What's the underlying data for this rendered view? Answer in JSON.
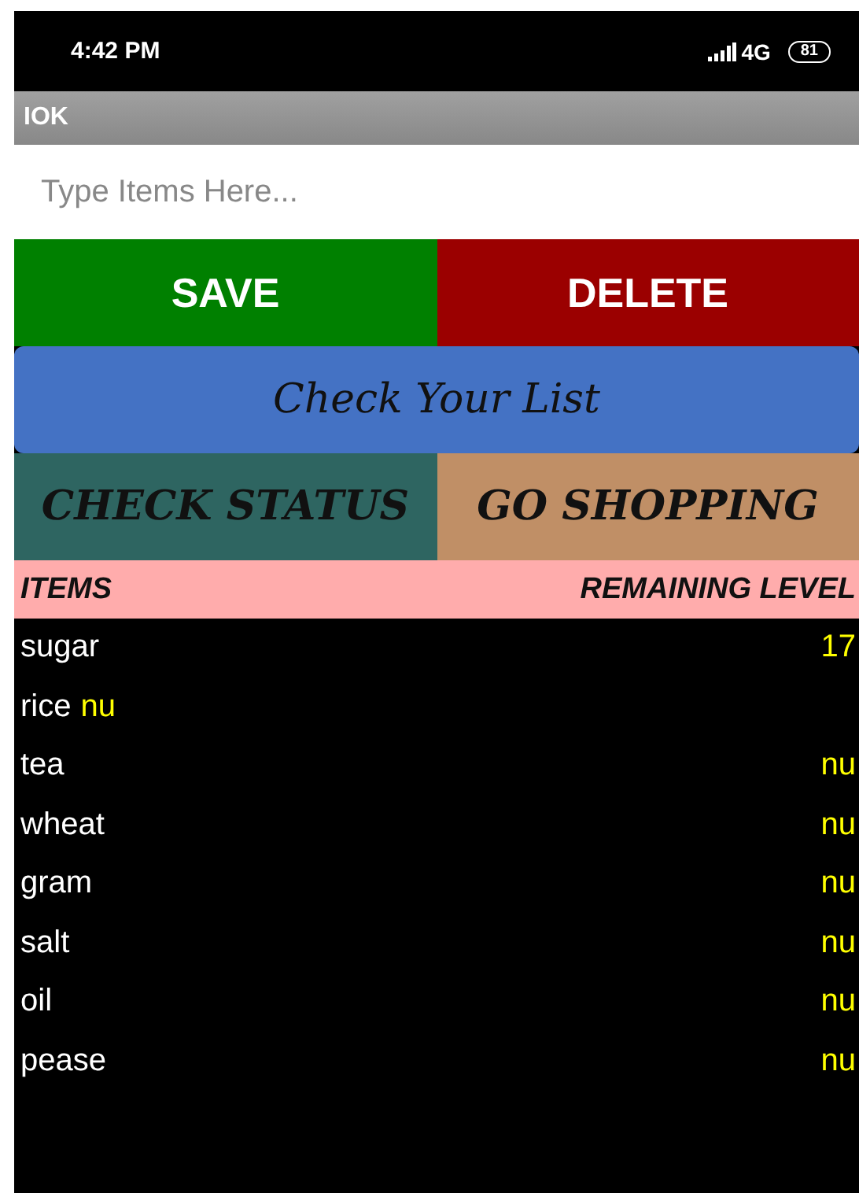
{
  "status_bar": {
    "time": "4:42 PM",
    "network": "4G",
    "battery": "81"
  },
  "app_bar": {
    "title": "IOK"
  },
  "input": {
    "placeholder": "Type Items Here..."
  },
  "buttons": [
    {
      "label": "SAVE",
      "color": "#008000"
    },
    {
      "label": "DELETE",
      "color": "#9b0000"
    }
  ],
  "list_button": {
    "label": "Check Your List"
  },
  "actions": [
    {
      "label": "CHECK STATUS",
      "color": "#2e6561"
    },
    {
      "label": "GO SHOPPING",
      "color": "#c08f66"
    }
  ],
  "table": {
    "columns": [
      "ITEMS",
      "REMAINING LEVEL"
    ],
    "rows": [
      {
        "item": "sugar",
        "value": "17"
      },
      {
        "item": "rice",
        "item_note": "nu"
      },
      {
        "item": "tea",
        "value": "nu"
      },
      {
        "item": "wheat",
        "value": "nu"
      },
      {
        "item": "gram",
        "value": "nu"
      },
      {
        "item": "salt",
        "value": "nu"
      },
      {
        "item": "oil",
        "value": "nu"
      },
      {
        "item": "pease",
        "value": "nu"
      }
    ]
  }
}
